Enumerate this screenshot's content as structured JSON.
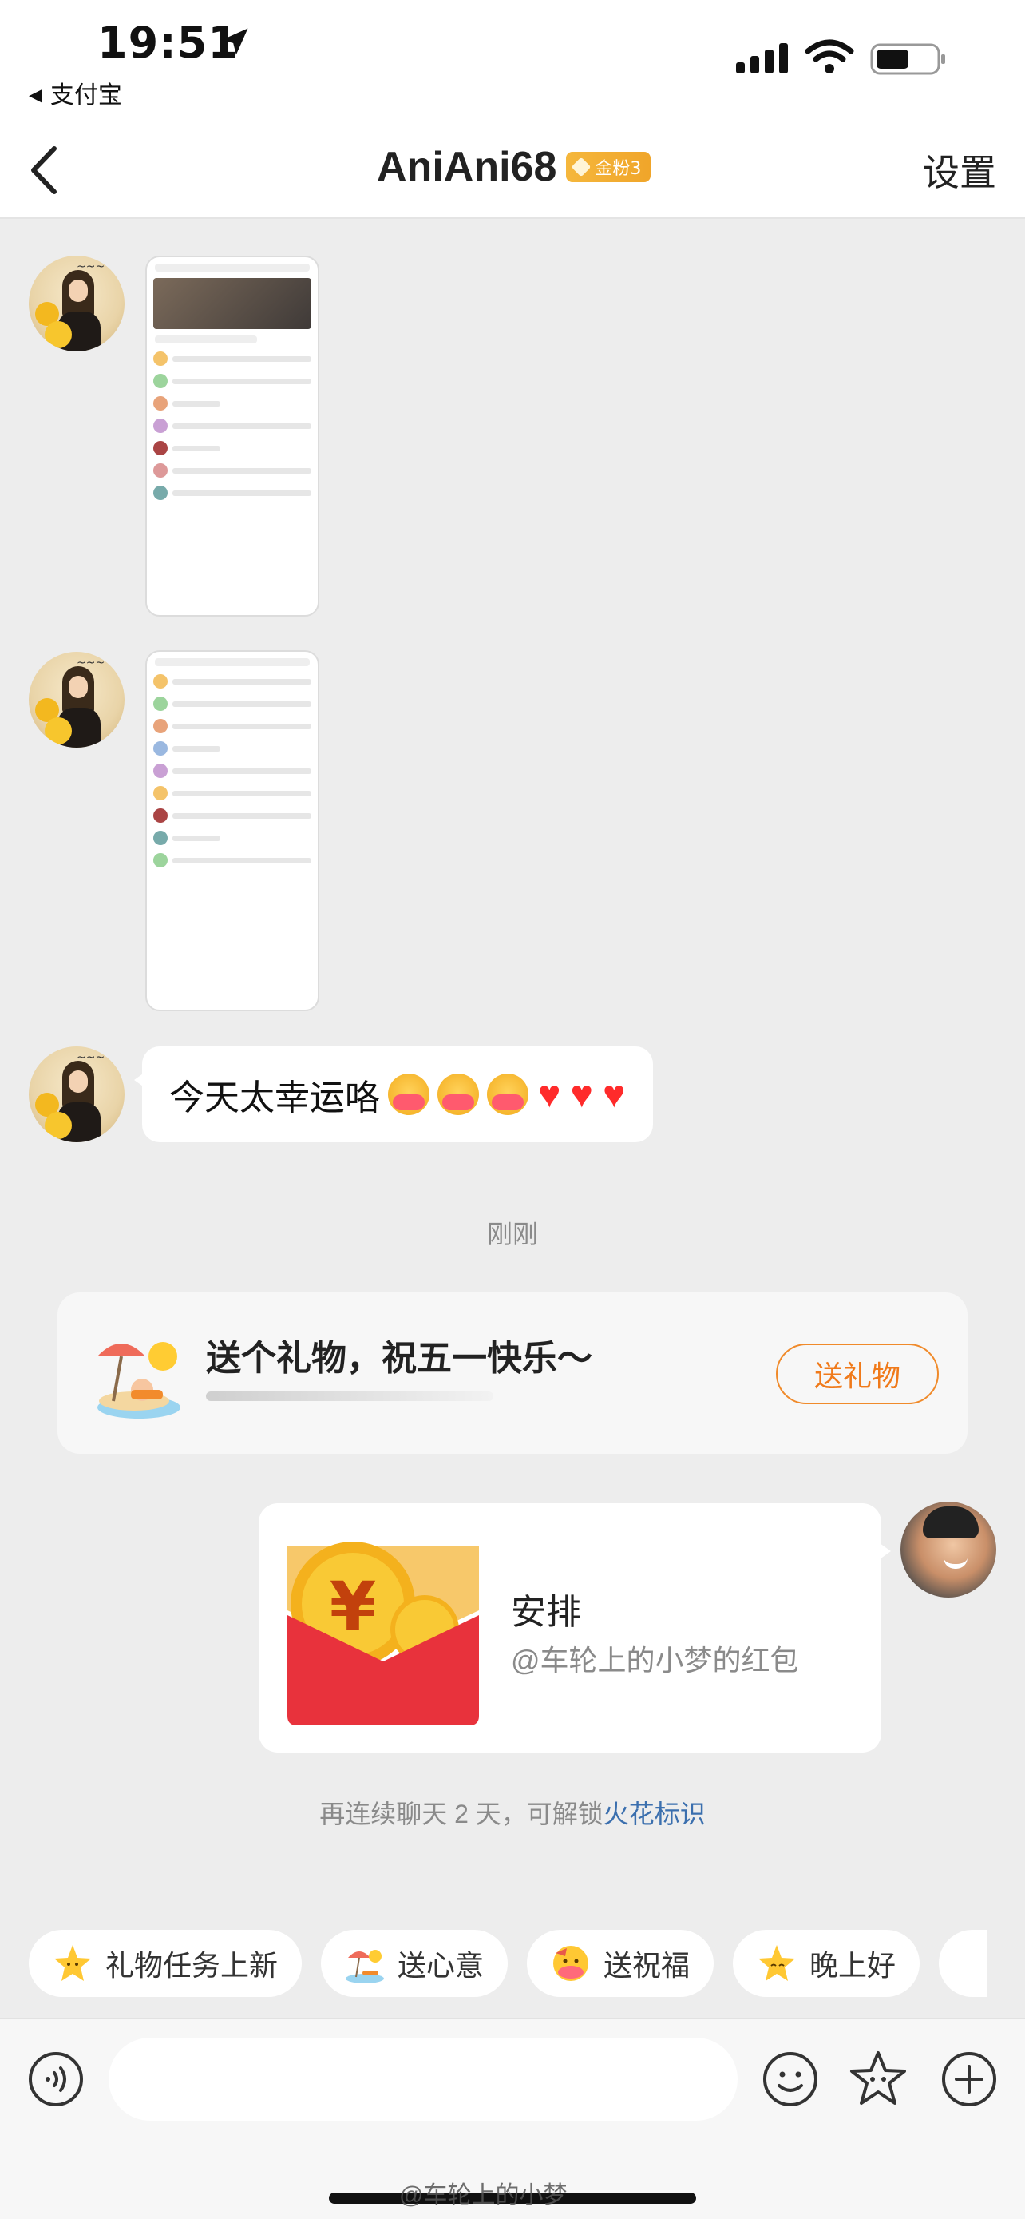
{
  "status_bar": {
    "time": "19:51",
    "back_app": "支付宝"
  },
  "header": {
    "title": "AniAni68",
    "badge": "金粉3",
    "settings": "设置"
  },
  "messages": {
    "text_message": "今天太幸运咯",
    "time_separator": "刚刚"
  },
  "gift_card": {
    "title": "送个礼物，祝五一快乐～",
    "button": "送礼物"
  },
  "red_packet": {
    "title": "安排",
    "subtitle": "@车轮上的小梦的红包"
  },
  "streak": {
    "text": "再连续聊天 2 天，可解锁",
    "link": "火花标识"
  },
  "quick_chips": [
    {
      "label": "礼物任务上新",
      "icon": "star-icon"
    },
    {
      "label": "送心意",
      "icon": "beach-icon"
    },
    {
      "label": "送祝福",
      "icon": "hug-emoji-icon"
    },
    {
      "label": "晚上好",
      "icon": "star-icon"
    }
  ],
  "input": {
    "placeholder": ""
  },
  "watermark": "@车轮上的小梦",
  "colors": {
    "accent_orange": "#f07a1a",
    "link_blue": "#3b6fae",
    "badge_gold": "#f5b73c",
    "red_packet": "#e8323c"
  }
}
